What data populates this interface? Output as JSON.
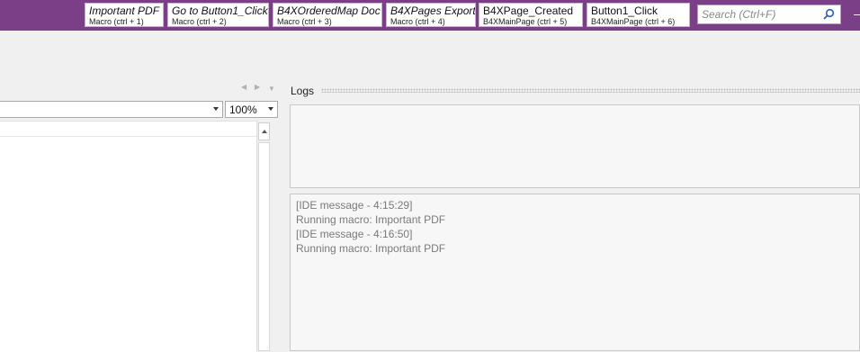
{
  "macros": [
    {
      "title": "Important PDF",
      "sub": "Macro  (ctrl + 1)",
      "italic": true
    },
    {
      "title": "Go to Button1_Click",
      "sub": "Macro  (ctrl + 2)",
      "italic": true
    },
    {
      "title": "B4XOrderedMap Doc",
      "sub": "Macro  (ctrl + 3)",
      "italic": true
    },
    {
      "title": "B4XPages Export",
      "sub": "Macro  (ctrl + 4)",
      "italic": true
    },
    {
      "title": "B4XPage_Created",
      "sub": "B4XMainPage  (ctrl + 5)",
      "italic": false
    },
    {
      "title": "Button1_Click",
      "sub": "B4XMainPage  (ctrl + 6)",
      "italic": false
    }
  ],
  "search": {
    "placeholder": "Search (Ctrl+F)"
  },
  "extra_button": "–",
  "editor": {
    "zoom": "100%"
  },
  "logs": {
    "title": "Logs",
    "lines": [
      "[IDE message - 4:15:29]",
      "Running macro: Important PDF",
      "[IDE message - 4:16:50]",
      "Running macro: Important PDF"
    ]
  },
  "colors": {
    "topbar": "#7b3f87",
    "log_text": "#7a7a7a"
  }
}
